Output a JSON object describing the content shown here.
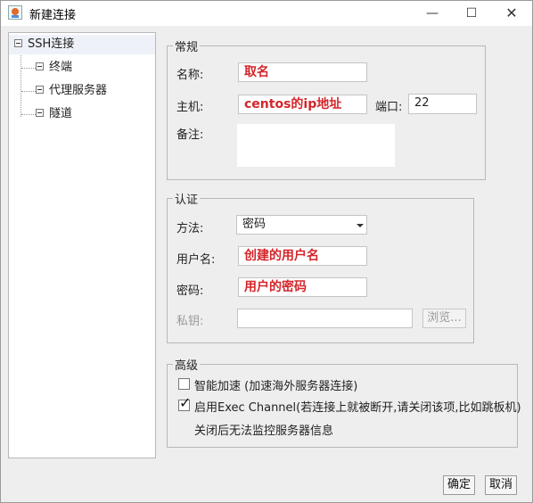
{
  "window": {
    "title": "新建连接",
    "buttons": {
      "minimize": "—",
      "maximize": "☐",
      "close": "✕"
    }
  },
  "tree": {
    "root": {
      "label": "SSH连接",
      "selected": true
    },
    "children": [
      {
        "label": "终端"
      },
      {
        "label": "代理服务器"
      },
      {
        "label": "隧道"
      }
    ]
  },
  "general": {
    "legend": "常规",
    "name_label": "名称:",
    "name_value": "取名",
    "host_label": "主机:",
    "host_value": "centos的ip地址",
    "port_label": "端口:",
    "port_value": "22",
    "note_label": "备注:",
    "note_value": ""
  },
  "auth": {
    "legend": "认证",
    "method_label": "方法:",
    "method_value": "密码",
    "username_label": "用户名:",
    "username_value": "创建的用户名",
    "password_label": "密码:",
    "password_value": "用户的密码",
    "key_label": "私钥:",
    "key_value": "",
    "browse_label": "浏览..."
  },
  "advanced": {
    "legend": "高级",
    "accel_label": "智能加速 (加速海外服务器连接)",
    "accel_checked": false,
    "exec_label": "启用Exec Channel(若连接上就被断开,请关闭该项,比如跳板机)",
    "exec_checked": true,
    "exec_note": "关闭后无法监控服务器信息"
  },
  "footer": {
    "ok_label": "确定",
    "cancel_label": "取消"
  }
}
